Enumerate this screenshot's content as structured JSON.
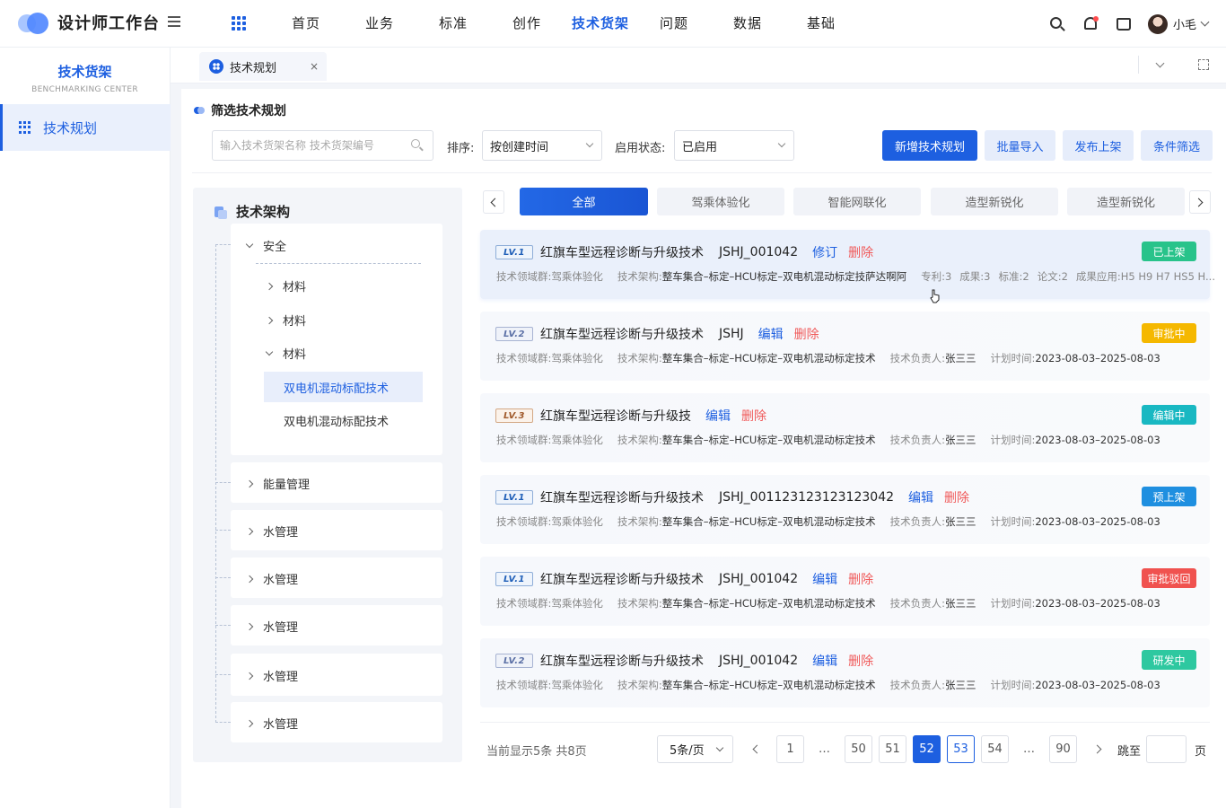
{
  "app": {
    "title": "设计师工作台"
  },
  "nav": {
    "items": [
      "首页",
      "业务",
      "标准",
      "创作",
      "技术货架",
      "问题",
      "数据",
      "基础"
    ],
    "active_index": 4
  },
  "user": {
    "name": "小毛"
  },
  "sidebar": {
    "title": "技术货架",
    "subtitle": "BENCHMARKING CENTER",
    "items": [
      {
        "label": "技术规划",
        "active": true
      }
    ]
  },
  "tabs": {
    "open": [
      {
        "label": "技术规划",
        "close": "×"
      }
    ]
  },
  "section": {
    "title": "筛选技术规划"
  },
  "filters": {
    "search_placeholder": "输入技术货架名称 技术货架编号",
    "sort_label": "排序:",
    "sort_value": "按创建时间",
    "status_label": "启用状态:",
    "status_value": "已启用"
  },
  "actions": {
    "add": "新增技术规划",
    "import": "批量导入",
    "publish": "发布上架",
    "filter": "条件筛选"
  },
  "tree": {
    "title": "技术架构",
    "root": {
      "label": "安全",
      "children": [
        "材料",
        "材料",
        "材料"
      ]
    },
    "selected_leaf": "双电机混动标配技术",
    "leaf2": "双电机混动标配技术",
    "groups": [
      "能量管理",
      "水管理",
      "水管理",
      "水管理",
      "水管理",
      "水管理"
    ]
  },
  "categories": {
    "items": [
      "全部",
      "驾乘体验化",
      "智能网联化",
      "造型新锐化",
      "造型新锐化"
    ],
    "active_index": 0
  },
  "cards": [
    {
      "level": "LV.1",
      "name": "红旗车型远程诊断与升级技术",
      "code": "JSHJ_001042",
      "action": "修订",
      "delete": "删除",
      "meta": [
        "技术领域群:驾乘体验化",
        "技术架构:",
        "专利:3",
        "成果:3",
        "标准:2",
        "论文:2",
        "成果应用:H5 H9 H7 HS5 H..."
      ],
      "arch": "整车集合–标定–HCU标定–双电机混动标定技萨达啊阿",
      "status": "已上架",
      "status_color": "#28c38a"
    },
    {
      "level": "LV.2",
      "name": "红旗车型远程诊断与升级技术",
      "code": "JSHJ",
      "action": "编辑",
      "delete": "删除",
      "domain": "技术领域群:驾乘体验化",
      "arch_label": "技术架构:",
      "arch": "整车集合–标定–HCU标定–双电机混动标定技术",
      "owner_label": "技术负责人:",
      "owner": "张三三",
      "time_label": "计划时间:",
      "time": "2023-08-03–2025-08-03",
      "status": "审批中",
      "status_color": "#f5b800"
    },
    {
      "level": "LV.3",
      "name": "红旗车型远程诊断与升级技",
      "code": "",
      "action": "编辑",
      "delete": "删除",
      "domain": "技术领域群:驾乘体验化",
      "arch_label": "技术架构:",
      "arch": "整车集合–标定–HCU标定–双电机混动标定技术",
      "owner_label": "技术负责人:",
      "owner": "张三三",
      "time_label": "计划时间:",
      "time": "2023-08-03–2025-08-03",
      "status": "编辑中",
      "status_color": "#19b8c2"
    },
    {
      "level": "LV.1",
      "name": "红旗车型远程诊断与升级技术",
      "code": "JSHJ_001123123123123042",
      "action": "编辑",
      "delete": "删除",
      "domain": "技术领域群:驾乘体验化",
      "arch_label": "技术架构:",
      "arch": "整车集合–标定–HCU标定–双电机混动标定技术",
      "owner_label": "技术负责人:",
      "owner": "张三三",
      "time_label": "计划时间:",
      "time": "2023-08-03–2025-08-03",
      "status": "预上架",
      "status_color": "#1f8fe0"
    },
    {
      "level": "LV.1",
      "name": "红旗车型远程诊断与升级技术",
      "code": "JSHJ_001042",
      "action": "编辑",
      "delete": "删除",
      "domain": "技术领域群:驾乘体验化",
      "arch_label": "技术架构:",
      "arch": "整车集合–标定–HCU标定–双电机混动标定技术",
      "owner_label": "技术负责人:",
      "owner": "张三三",
      "time_label": "计划时间:",
      "time": "2023-08-03–2025-08-03",
      "status": "审批驳回",
      "status_color": "#f0524f"
    },
    {
      "level": "LV.2",
      "name": "红旗车型远程诊断与升级技术",
      "code": "JSHJ_001042",
      "action": "编辑",
      "delete": "删除",
      "domain": "技术领域群:驾乘体验化",
      "arch_label": "技术架构:",
      "arch": "整车集合–标定–HCU标定–双电机混动标定技术",
      "owner_label": "技术负责人:",
      "owner": "张三三",
      "time_label": "计划时间:",
      "time": "2023-08-03–2025-08-03",
      "status": "研发中",
      "status_color": "#2ec8a0"
    }
  ],
  "pagination": {
    "info": "当前显示5条 共8页",
    "page_size": "5条/页",
    "pages": [
      "1",
      "…",
      "50",
      "51",
      "52",
      "53",
      "54",
      "…",
      "90"
    ],
    "current": "52",
    "jump_label": "跳至",
    "page_unit": "页"
  },
  "colors": {
    "primary": "#1d5fe0"
  }
}
